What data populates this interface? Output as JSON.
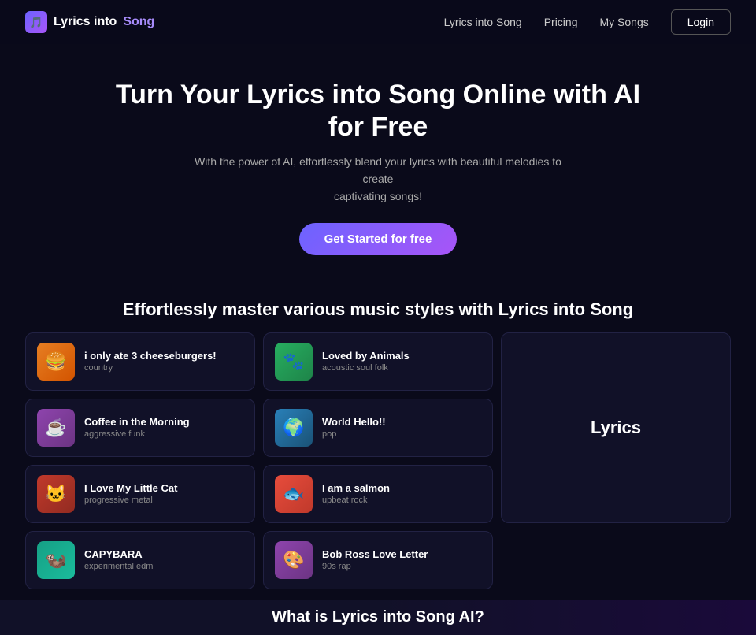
{
  "nav": {
    "logo_text_plain": "Lyrics into ",
    "logo_text_accent": "Song",
    "links": [
      {
        "label": "Lyrics into Song",
        "href": "#"
      },
      {
        "label": "Pricing",
        "href": "#"
      },
      {
        "label": "My Songs",
        "href": "#"
      }
    ],
    "login_label": "Login"
  },
  "hero": {
    "title": "Turn Your Lyrics into Song Online with AI for Free",
    "subtitle_line1": "With the power of AI, effortlessly blend your lyrics with beautiful melodies to create",
    "subtitle_line2": "captivating songs!",
    "cta_label": "Get Started for free"
  },
  "section": {
    "title": "Effortlessly master various music styles with Lyrics into Song"
  },
  "cards": [
    {
      "id": "burger",
      "title": "i only ate 3 cheeseburgers!",
      "genre": "country",
      "emoji": "🍔",
      "thumb_class": "thumb-burger"
    },
    {
      "id": "animals",
      "title": "Loved by Animals",
      "genre": "acoustic soul folk",
      "emoji": "🐾",
      "thumb_class": "thumb-animals"
    },
    {
      "id": "coffee",
      "title": "Coffee in the Morning",
      "genre": "aggressive funk",
      "emoji": "☕",
      "thumb_class": "thumb-coffee"
    },
    {
      "id": "world",
      "title": "World Hello!!",
      "genre": "pop",
      "emoji": "🌍",
      "thumb_class": "thumb-world"
    },
    {
      "id": "cat",
      "title": "I Love My Little Cat",
      "genre": "progressive metal",
      "emoji": "🐱",
      "thumb_class": "thumb-cat"
    },
    {
      "id": "salmon",
      "title": "I am a salmon",
      "genre": "upbeat rock",
      "emoji": "🐟",
      "thumb_class": "thumb-salmon"
    },
    {
      "id": "capybara",
      "title": "CAPYBARA",
      "genre": "experimental edm",
      "emoji": "🦦",
      "thumb_class": "thumb-capybara"
    },
    {
      "id": "bob",
      "title": "Bob Ross Love Letter",
      "genre": "90s rap",
      "emoji": "🎨",
      "thumb_class": "thumb-bob"
    }
  ],
  "lyrics_panel": {
    "label": "Lyrics"
  },
  "bottom": {
    "text": "What is Lyrics into Song AI?"
  }
}
